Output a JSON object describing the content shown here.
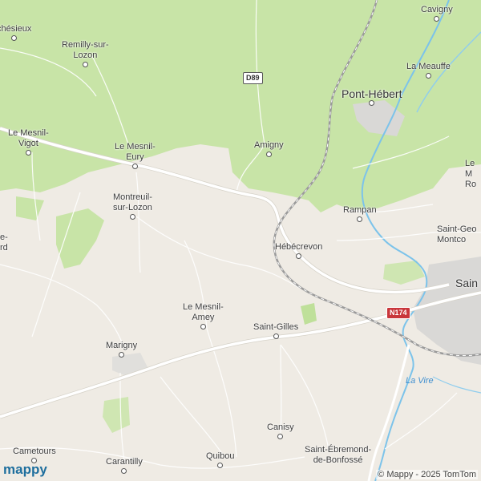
{
  "map": {
    "road_shields": [
      {
        "ref": "D89",
        "kind": "departmental"
      },
      {
        "ref": "N174",
        "kind": "national"
      }
    ],
    "places": [
      {
        "id": "vechesieux",
        "name": "chésieux"
      },
      {
        "id": "remilly",
        "name": "Remilly-sur-\nLozon"
      },
      {
        "id": "cavigny",
        "name": "Cavigny"
      },
      {
        "id": "la-meauffe",
        "name": "La Meauffe"
      },
      {
        "id": "pont-hebert",
        "name": "Pont-Hébert"
      },
      {
        "id": "le-mesnil-vigot",
        "name": "Le Mesnil-\nVigot"
      },
      {
        "id": "le-mesnil-eury",
        "name": "Le Mesnil-\nEury"
      },
      {
        "id": "amigny",
        "name": "Amigny"
      },
      {
        "id": "le-mesnil-ro",
        "name": "Le M\nRo"
      },
      {
        "id": "montreuil",
        "name": "Montreuil-\nsur-Lozon"
      },
      {
        "id": "rampan",
        "name": "Rampan"
      },
      {
        "id": "saint-georges",
        "name": "Saint-Geo\nMontco"
      },
      {
        "id": "left-edge",
        "name": "e-\nrd"
      },
      {
        "id": "hebecrevon",
        "name": "Hébécrevon"
      },
      {
        "id": "saint-lo",
        "name": "Sain"
      },
      {
        "id": "le-mesnil-amey",
        "name": "Le Mesnil-\nAmey"
      },
      {
        "id": "saint-gilles",
        "name": "Saint-Gilles"
      },
      {
        "id": "marigny",
        "name": "Marigny"
      },
      {
        "id": "canisy",
        "name": "Canisy"
      },
      {
        "id": "cametours",
        "name": "Cametours"
      },
      {
        "id": "carantilly",
        "name": "Carantilly"
      },
      {
        "id": "quibou",
        "name": "Quibou"
      },
      {
        "id": "saint-ebremond",
        "name": "Saint-Ébremond-\nde-Bonfossé"
      }
    ],
    "river_label": "La Vire",
    "colors": {
      "land": "#efebe4",
      "forest": "#c7e4a6",
      "urban": "#d8d8d8",
      "major_road": "#ffffff",
      "rail": "#9a9a9a",
      "river": "#7cc3ea",
      "national_shield": "#c9363b"
    }
  },
  "branding": {
    "logo": "mappy",
    "copyright": "© Mappy - 2025 TomTom"
  }
}
